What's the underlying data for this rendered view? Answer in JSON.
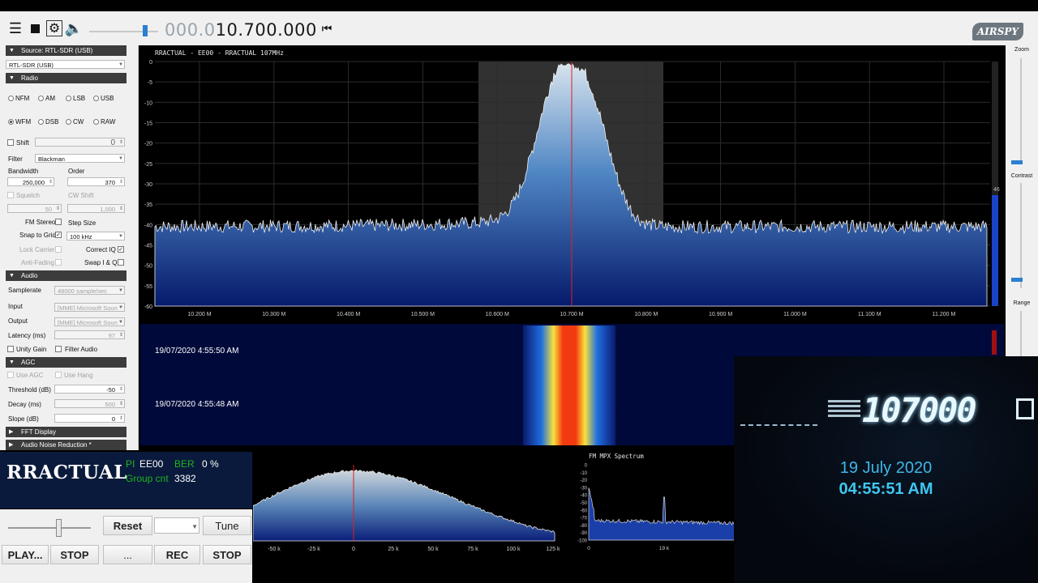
{
  "toolbar": {
    "freq_dim": "000.0",
    "freq_bright": "10.700.000",
    "logo": "AIRSPY"
  },
  "left": {
    "source_header": "Source: RTL-SDR (USB)",
    "source_value": "RTL-SDR (USB)",
    "radio_header": "Radio",
    "modes": [
      "NFM",
      "AM",
      "LSB",
      "USB",
      "WFM",
      "DSB",
      "CW",
      "RAW"
    ],
    "selected_mode": "WFM",
    "shift_label": "Shift",
    "shift_value": "0",
    "filter_label": "Filter",
    "filter_value": "Blackman",
    "bandwidth_label": "Bandwidth",
    "bandwidth_value": "250,000",
    "order_label": "Order",
    "order_value": "370",
    "squelch_label": "Squelch",
    "squelch_value": "50",
    "cwshift_label": "CW Shift",
    "cwshift_value": "1,000",
    "fmstereo_label": "FM Stereo",
    "stepsize_label": "Step Size",
    "snap_label": "Snap to Grid",
    "snap_value": "100 kHz",
    "lockcarrier_label": "Lock Carrier",
    "correctiq_label": "Correct IQ",
    "antifading_label": "Anti-Fading",
    "swapiq_label": "Swap I & Q",
    "audio_header": "Audio",
    "samplerate_label": "Samplerate",
    "samplerate_value": "48000 sample/sec",
    "input_label": "Input",
    "input_value": "[MME] Microsoft Soun",
    "output_label": "Output",
    "output_value": "[MME] Microsoft Soun",
    "latency_label": "Latency (ms)",
    "latency_value": "97",
    "unitygain_label": "Unity Gain",
    "filteraudio_label": "Filter Audio",
    "agc_header": "AGC",
    "useagc_label": "Use AGC",
    "usehang_label": "Use Hang",
    "threshold_label": "Threshold (dB)",
    "threshold_value": "-50",
    "decay_label": "Decay (ms)",
    "decay_value": "500",
    "slope_label": "Slope (dB)",
    "slope_value": "0",
    "fft_header": "FFT Display",
    "noise_header": "Audio Noise Reduction *"
  },
  "spectrum": {
    "title": "RRACTUAL - EE00 - RRACTUAL 107MHz",
    "y_ticks": [
      "0",
      "-5",
      "-10",
      "-15",
      "-20",
      "-25",
      "-30",
      "-35",
      "-40",
      "-45",
      "-50",
      "-55",
      "-60"
    ],
    "x_ticks": [
      "10.200 M",
      "10.300 M",
      "10.400 M",
      "10.500 M",
      "10.600 M",
      "10.700 M",
      "10.800 M",
      "10.900 M",
      "11.000 M",
      "11.100 M",
      "11.200 M"
    ],
    "level_readout": "46"
  },
  "waterfall": {
    "timestamp1": "19/07/2020 4:55:50 AM",
    "timestamp2": "19/07/2020 4:55:48 AM"
  },
  "ifpanel": {
    "x_ticks": [
      "-50 k",
      "-25 k",
      "0",
      "25 k",
      "50 k",
      "75 k",
      "100 k",
      "125 k"
    ]
  },
  "mpx": {
    "title": "FM MPX Spectrum",
    "y_ticks": [
      "0",
      "-10",
      "-20",
      "-30",
      "-40",
      "-50",
      "-60",
      "-70",
      "-80",
      "-90",
      "-100"
    ],
    "x_ticks": [
      "0",
      "19 k"
    ]
  },
  "rightstrip": {
    "zoom": "Zoom",
    "contrast": "Contrast",
    "range": "Range"
  },
  "rds": {
    "station": "RRACTUAL",
    "pi_label": "PI",
    "pi_value": "EE00",
    "ber_label": "BER",
    "ber_value": "0 %",
    "group_label": "Group cnt",
    "group_value": "3382"
  },
  "controls": {
    "reset": "Reset",
    "tune": "Tune",
    "play": "PLAY...",
    "stop1": "STOP",
    "more": "...",
    "rec": "REC",
    "stop2": "STOP"
  },
  "photo": {
    "lcd_freq": "107000",
    "date": "19 July 2020",
    "time": "04:55:51 AM"
  }
}
